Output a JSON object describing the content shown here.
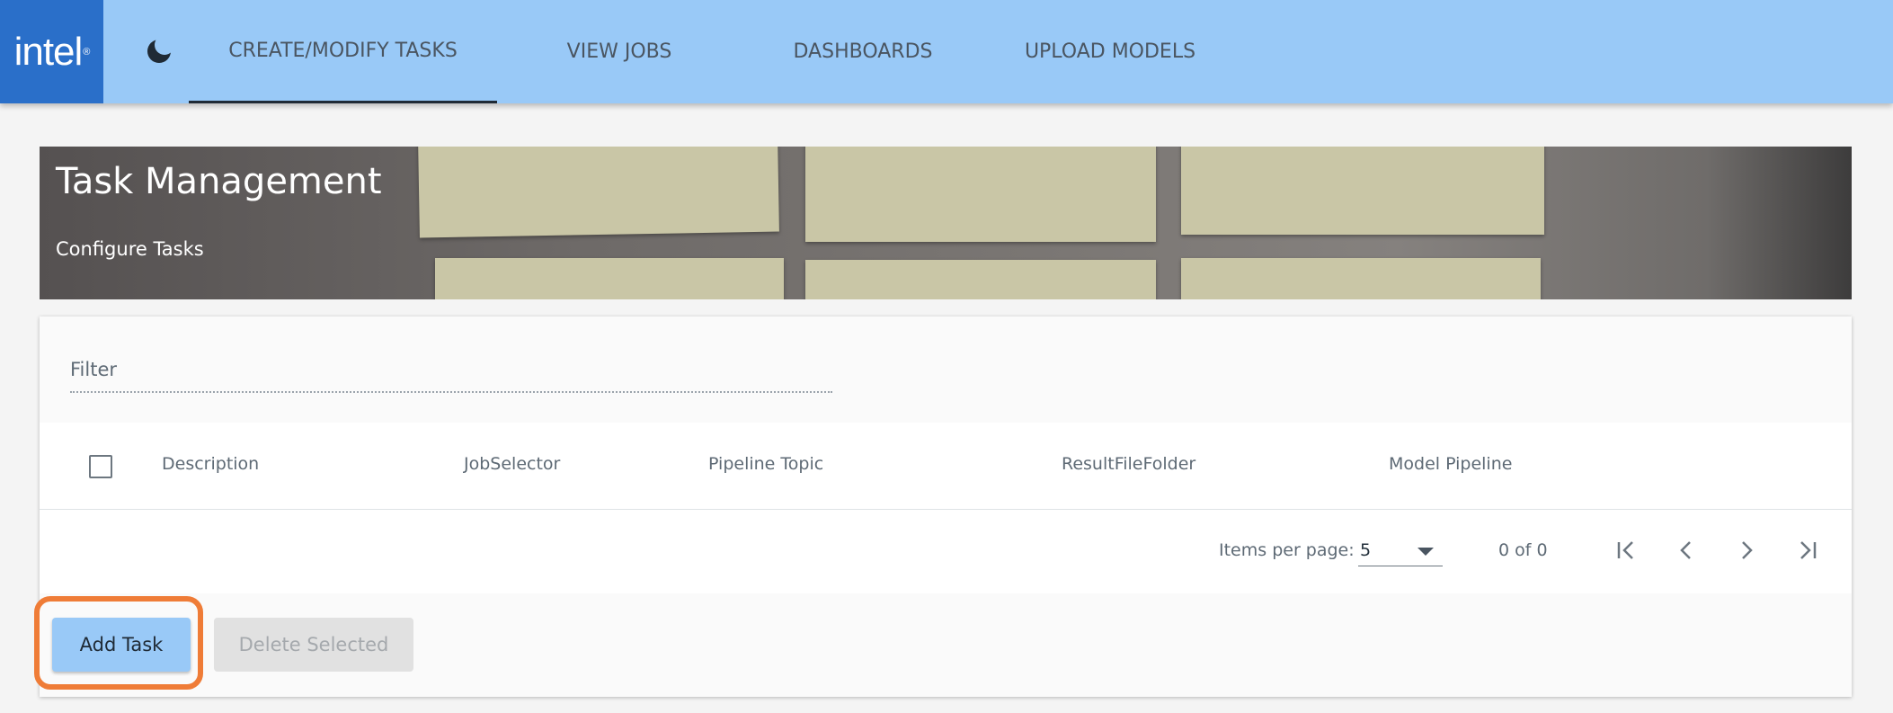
{
  "nav": {
    "logo_text": "intel",
    "logo_reg": "®",
    "theme_icon": "moon-icon",
    "tabs": [
      {
        "label": "CREATE/MODIFY TASKS",
        "active": true
      },
      {
        "label": "VIEW JOBS",
        "active": false
      },
      {
        "label": "DASHBOARDS",
        "active": false
      },
      {
        "label": "UPLOAD MODELS",
        "active": false
      }
    ]
  },
  "banner": {
    "title": "Task Management",
    "subtitle": "Configure Tasks"
  },
  "filter": {
    "placeholder": "Filter",
    "value": ""
  },
  "table": {
    "columns": [
      "Description",
      "JobSelector",
      "Pipeline Topic",
      "ResultFileFolder",
      "Model Pipeline"
    ],
    "rows": []
  },
  "paginator": {
    "items_per_page_label": "Items per page:",
    "items_per_page_value": "5",
    "range_label": "0 of 0"
  },
  "actions": {
    "add_label": "Add Task",
    "delete_label": "Delete Selected"
  },
  "colors": {
    "nav_bg": "#99c9f7",
    "logo_bg": "#2a6fc9",
    "primary_button": "#99c9f7",
    "highlight": "#ef7c37"
  }
}
